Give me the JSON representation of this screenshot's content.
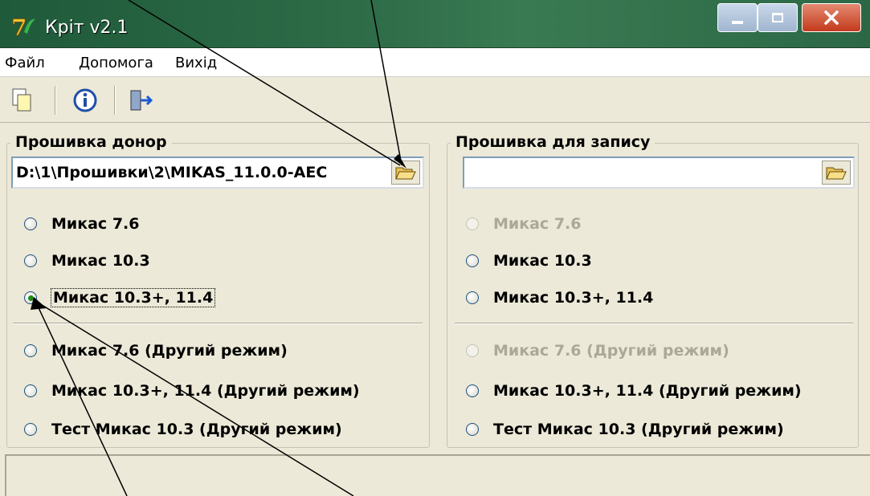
{
  "window": {
    "title": "Кріт v2.1"
  },
  "menu": {
    "items": [
      "Файл",
      "Допомога",
      "Вихід"
    ]
  },
  "toolbar": {
    "icons": [
      "new-file-icon",
      "info-icon",
      "exit-door-icon"
    ]
  },
  "donor": {
    "legend": "Прошивка донор",
    "path": "D:\\1\\Прошивки\\2\\MIKAS_11.0.0-AEC",
    "options": [
      "Микас 7.6",
      "Микас 10.3",
      "Микас 10.3+, 11.4",
      "Микас 7.6 (Другий режим)",
      "Микас 10.3+, 11.4 (Другий режим)",
      "Тест Микас 10.3 (Другий режим)"
    ],
    "selected_index": 2
  },
  "target": {
    "legend": "Прошивка для запису",
    "path": "",
    "options": [
      "Микас 7.6",
      "Микас 10.3",
      "Микас 10.3+, 11.4",
      "Микас 7.6 (Другий режим)",
      "Микас 10.3+, 11.4 (Другий режим)",
      "Тест Микас 10.3 (Другий режим)"
    ],
    "disabled_indices": [
      0,
      3
    ]
  },
  "colors": {
    "titlebar": "#2f6e49",
    "disabled_text": "#aca899",
    "annotation": "#000000"
  }
}
